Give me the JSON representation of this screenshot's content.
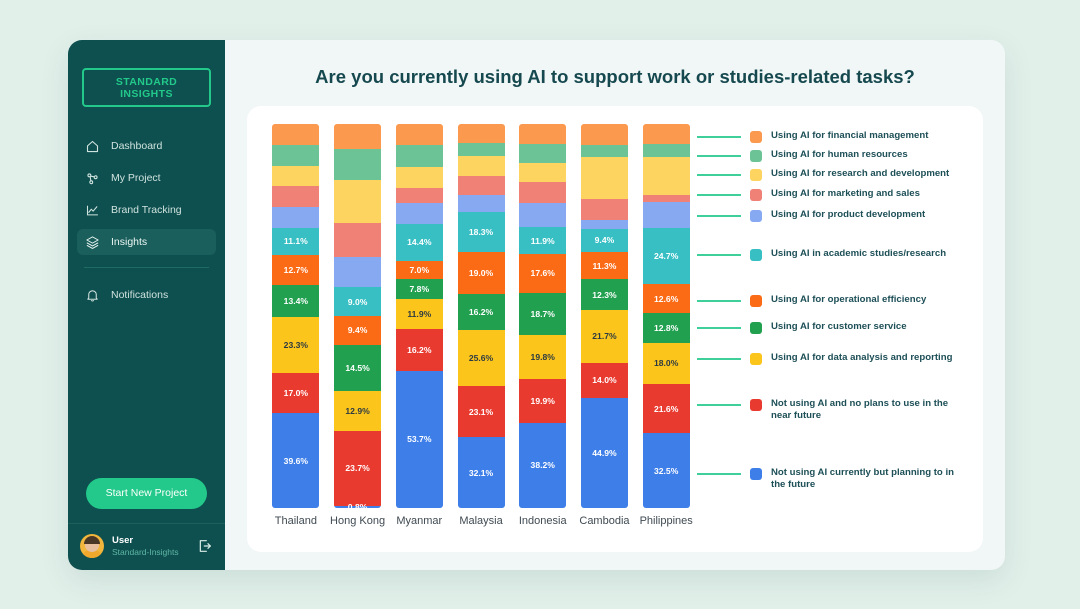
{
  "sidebar": {
    "brand": "STANDARD INSIGHTS",
    "items": [
      {
        "label": "Dashboard",
        "icon": "home-icon"
      },
      {
        "label": "My Project",
        "icon": "network-icon"
      },
      {
        "label": "Brand Tracking",
        "icon": "chart-line-icon"
      },
      {
        "label": "Insights",
        "icon": "layers-icon"
      }
    ],
    "secondary": [
      {
        "label": "Notifications",
        "icon": "bell-icon"
      }
    ],
    "cta_label": "Start New Project",
    "user": {
      "name": "User",
      "org": "Standard-Insights",
      "logout_icon": "logout-icon"
    }
  },
  "header": {
    "title": "Are you currently using AI to support work or studies-related tasks?"
  },
  "colors": {
    "bg": "#e2f0ea",
    "sidebar": "#0e4f4f",
    "accent": "#22c98a",
    "title": "#16494f",
    "leader": "#3ecf9a"
  },
  "chart_data": {
    "type": "bar",
    "subtype": "stacked-column-100",
    "title": "Are you currently using AI to support work or studies-related tasks?",
    "xlabel": "",
    "ylabel": "",
    "grid": false,
    "legend_position": "right",
    "value_suffix": "%",
    "categories": [
      "Thailand",
      "Hong Kong",
      "Myanmar",
      "Malaysia",
      "Indonesia",
      "Cambodia",
      "Philippines"
    ],
    "series": [
      {
        "name": "Using AI for financial management",
        "color": "#fb9a4e",
        "labeled": false,
        "values": [
          8.7,
          8.1,
          8.3,
          8.5,
          9.0,
          8.4,
          8.8
        ]
      },
      {
        "name": "Using AI for human resources",
        "color": "#6cc395",
        "labeled": false,
        "values": [
          8.7,
          9.6,
          8.3,
          5.8,
          8.5,
          5.2,
          5.5
        ]
      },
      {
        "name": "Using AI for research and development",
        "color": "#fcd45f",
        "labeled": false,
        "values": [
          8.7,
          13.7,
          8.3,
          9.4,
          8.5,
          17.0,
          16.5
        ]
      },
      {
        "name": "Using AI for marketing and sales",
        "color": "#ef8177",
        "labeled": false,
        "values": [
          8.7,
          11.1,
          5.8,
          8.5,
          9.5,
          8.4,
          3.3
        ]
      },
      {
        "name": "Using AI for product development",
        "color": "#87a9f2",
        "labeled": false,
        "values": [
          8.7,
          9.6,
          8.3,
          7.7,
          11.0,
          3.5,
          11.0
        ]
      },
      {
        "name": "Using AI in academic studies/research",
        "color": "#38bfc4",
        "labeled": true,
        "values": [
          11.1,
          9.0,
          14.4,
          18.3,
          11.9,
          9.4,
          24.7
        ]
      },
      {
        "name": "Using AI for operational efficiency",
        "color": "#fb6b16",
        "labeled": true,
        "values": [
          12.7,
          9.4,
          7.0,
          19.0,
          17.6,
          11.3,
          12.6
        ]
      },
      {
        "name": "Using AI for customer service",
        "color": "#21a050",
        "labeled": true,
        "values": [
          13.4,
          14.5,
          7.8,
          16.2,
          18.7,
          12.3,
          12.8
        ]
      },
      {
        "name": "Using AI for data analysis and reporting",
        "color": "#fcc51c",
        "labeled": true,
        "values": [
          23.3,
          12.9,
          11.9,
          25.6,
          19.8,
          21.7,
          18.0
        ]
      },
      {
        "name": "Not using AI and no plans to use in the near future",
        "color": "#e93a30",
        "labeled": true,
        "values": [
          17.0,
          23.7,
          16.2,
          23.1,
          19.9,
          14.0,
          21.6
        ]
      },
      {
        "name": "Not using AI currently but planning to in the future",
        "color": "#3d7ee8",
        "labeled": true,
        "values": [
          39.6,
          0.8,
          53.7,
          32.1,
          38.2,
          44.9,
          32.5
        ]
      }
    ],
    "legend_items": [
      {
        "label": "Using AI for financial management",
        "color": "#fb9a4e"
      },
      {
        "label": "Using AI for human resources",
        "color": "#6cc395"
      },
      {
        "label": "Using AI for research and development",
        "color": "#fcd45f"
      },
      {
        "label": "Using AI for marketing and sales",
        "color": "#ef8177"
      },
      {
        "label": "Using AI for product development",
        "color": "#87a9f2"
      },
      {
        "label": "Using AI in academic studies/research",
        "color": "#38bfc4"
      },
      {
        "label": "Using AI for operational efficiency",
        "color": "#fb6b16"
      },
      {
        "label": "Using AI for customer service",
        "color": "#21a050"
      },
      {
        "label": "Using AI for data analysis and reporting",
        "color": "#fcc51c"
      },
      {
        "label": "Not using AI and no plans to use in the near future",
        "color": "#e93a30"
      },
      {
        "label": "Not using AI currently but planning to in the future",
        "color": "#3d7ee8"
      }
    ]
  }
}
